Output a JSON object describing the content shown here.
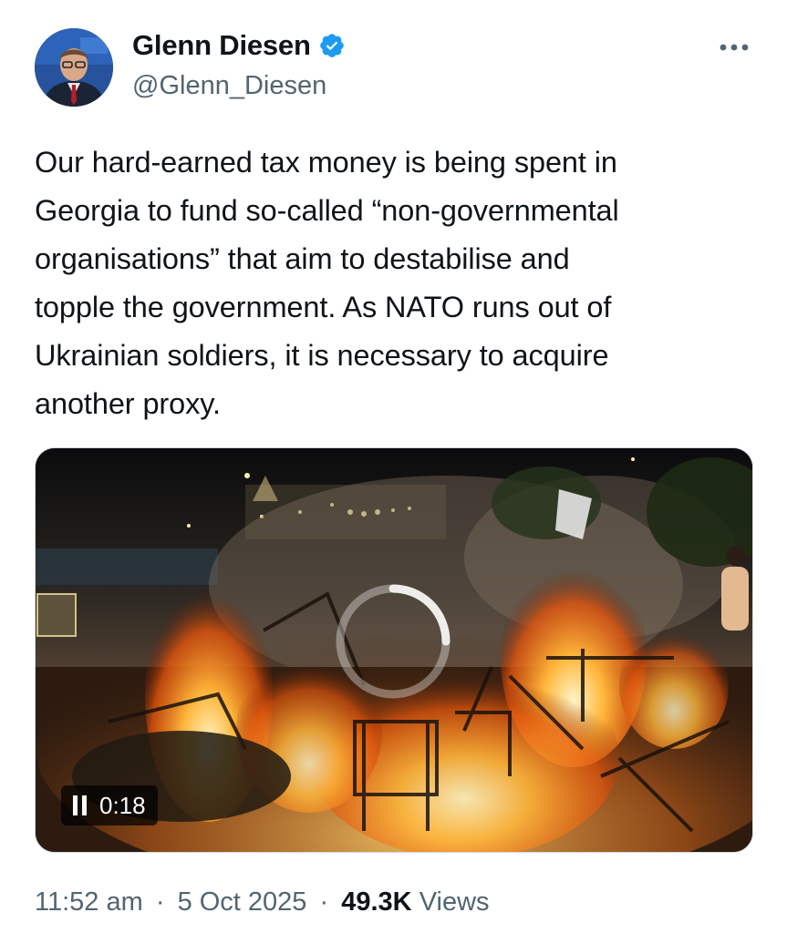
{
  "author": {
    "display_name": "Glenn Diesen",
    "handle": "@Glenn_Diesen",
    "avatar_icon": "profile-photo",
    "verified_icon": "verified-badge-icon",
    "verified_color": "#1d9bf0"
  },
  "more_icon": "more-options-icon",
  "tweet": {
    "text": "Our hard-earned tax money is being spent in\nGeorgia to fund so-called “non-governmental\norganisations” that aim to destabilise and\ntopple the government. As NATO runs out of\nUkrainian soldiers, it is necessary to acquire\nanother proxy."
  },
  "media": {
    "type": "video",
    "time": "0:18",
    "pause_icon": "pause-icon",
    "loading_icon": "loading-spinner-icon"
  },
  "meta": {
    "time": "11:52 am",
    "date": "5 Oct 2025",
    "separator": "·",
    "views_count": "49.3K",
    "views_label": "Views"
  }
}
